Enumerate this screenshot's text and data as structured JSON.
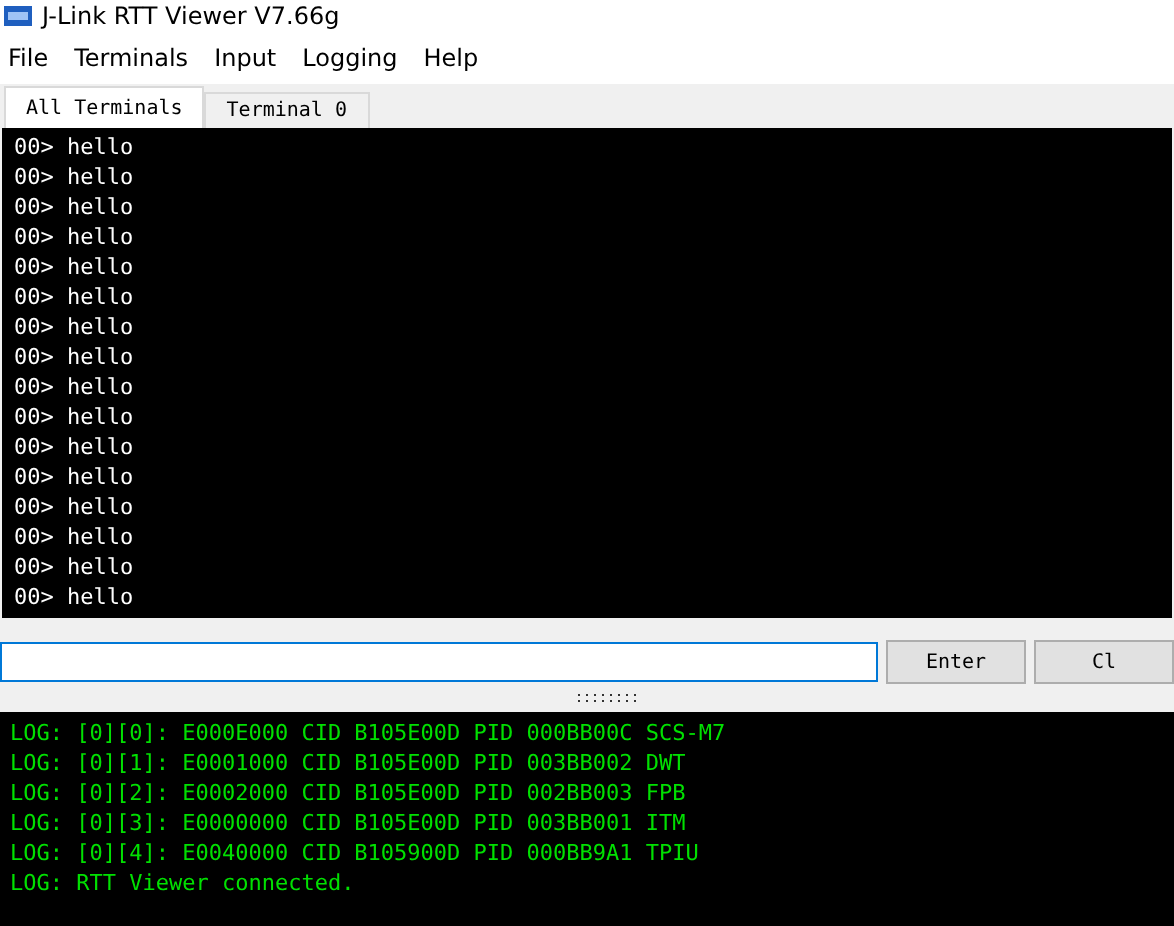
{
  "window": {
    "title": "J-Link RTT Viewer V7.66g"
  },
  "menu": [
    "File",
    "Terminals",
    "Input",
    "Logging",
    "Help"
  ],
  "tabs": [
    {
      "label": "All Terminals",
      "selected": true
    },
    {
      "label": "Terminal 0",
      "selected": false
    }
  ],
  "terminal": {
    "lines": [
      "00> hello",
      "00> hello",
      "00> hello",
      "00> hello",
      "00> hello",
      "00> hello",
      "00> hello",
      "00> hello",
      "00> hello",
      "00> hello",
      "00> hello",
      "00> hello",
      "00> hello",
      "00> hello",
      "00> hello",
      "00> hello"
    ]
  },
  "input": {
    "buttons": [
      "Enter",
      "Cl"
    ]
  },
  "log": {
    "lines": [
      "LOG: [0][0]: E000E000 CID B105E00D PID 000BB00C SCS-M7",
      "LOG: [0][1]: E0001000 CID B105E00D PID 003BB002 DWT",
      "LOG: [0][2]: E0002000 CID B105E00D PID 002BB003 FPB",
      "LOG: [0][3]: E0000000 CID B105E00D PID 003BB001 ITM",
      "LOG: [0][4]: E0040000 CID B105900D PID 000BB9A1 TPIU",
      "LOG: RTT Viewer connected."
    ]
  }
}
